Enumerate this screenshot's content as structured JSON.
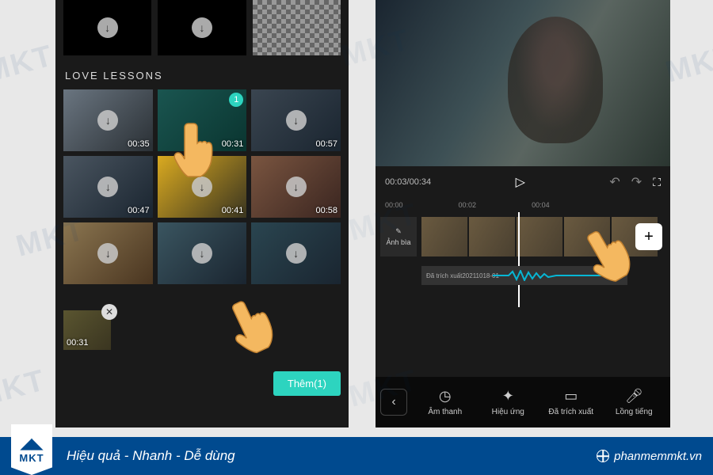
{
  "watermark_text": "MKT",
  "left": {
    "section_title": "LOVE LESSONS",
    "selected_badge": "1",
    "clips": [
      {
        "dur": "00:35"
      },
      {
        "dur": "00:31"
      },
      {
        "dur": "00:57"
      },
      {
        "dur": "00:47"
      },
      {
        "dur": "00:41"
      },
      {
        "dur": "00:58"
      },
      {
        "dur": ""
      },
      {
        "dur": ""
      },
      {
        "dur": ""
      }
    ],
    "selected_dur": "00:31",
    "add_button": "Thêm(1)"
  },
  "right": {
    "time": "00:03/00:34",
    "ruler": [
      "00:00",
      "00:02",
      "00:04"
    ],
    "cover_label": "Ảnh bìa",
    "audio_label": "Đã trích xuất20211018-01",
    "bottom": {
      "audio": "Âm thanh",
      "effect": "Hiệu ứng",
      "extracted": "Đã trích xuất",
      "voiceover": "Lồng tiếng"
    }
  },
  "footer": {
    "logo": "MKT",
    "tagline": "Hiệu quả - Nhanh - Dễ dùng",
    "site": "phanmemmkt.vn"
  }
}
